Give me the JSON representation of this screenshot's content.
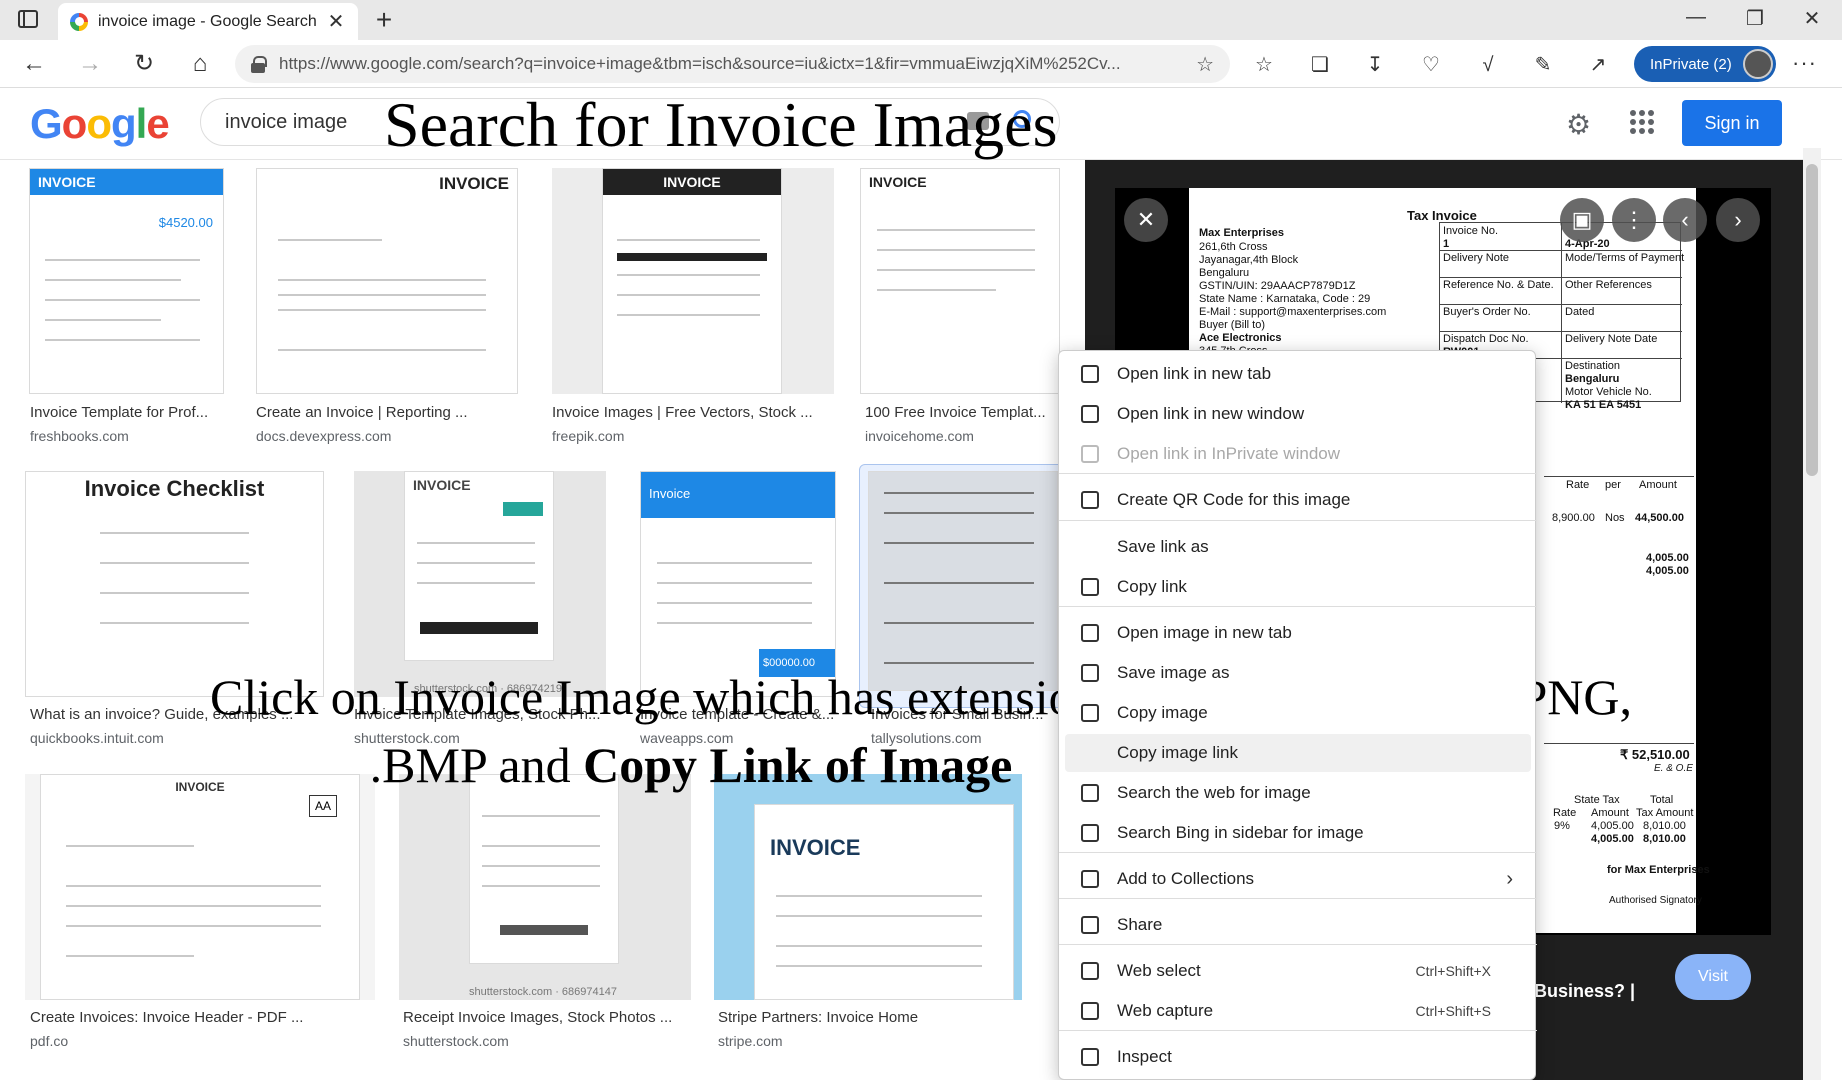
{
  "browser": {
    "tab_title": "invoice image - Google Search",
    "tab_close": "✕",
    "new_tab": "+",
    "url": "https://www.google.com/search?q=invoice+image&tbm=isch&source=iu&ictx=1&fir=vmmuaEiwzjqXiM%252Cv...",
    "inprivate_label": "InPrivate (2)",
    "window_minimize": "—",
    "window_restore": "❐",
    "window_close": "✕",
    "more": "···"
  },
  "google": {
    "logo": "Google",
    "search_value": "invoice image",
    "signin_label": "Sign in"
  },
  "overlay": {
    "title": "Search for Invoice Images",
    "caption_line1": "Click on Invoice Image which has extensions like- .JPEG, .JPG, .PNG,",
    "caption_line2_plain": ".BMP and ",
    "caption_line2_bold": "Copy Link of Image"
  },
  "results": [
    {
      "title": "Invoice Template for Prof...",
      "source": "freshbooks.com",
      "thumb_heading": "INVOICE",
      "thumb_amount": "$4520.00"
    },
    {
      "title": "Create an Invoice | Reporting ...",
      "source": "docs.devexpress.com",
      "thumb_heading": "INVOICE"
    },
    {
      "title": "Invoice Images | Free Vectors, Stock ...",
      "source": "freepik.com",
      "thumb_heading": "INVOICE"
    },
    {
      "title": "100 Free Invoice Templat...",
      "source": "invoicehome.com",
      "thumb_heading": "INVOICE"
    },
    {
      "title": "What is an invoice? Guide, examples ...",
      "source": "quickbooks.intuit.com",
      "thumb_heading": "Invoice Checklist"
    },
    {
      "title": "Invoice Template Images, Stock Ph...",
      "source": "shutterstock.com",
      "thumb_heading": "INVOICE",
      "thumb_footer": "shutterstock.com · 686974219"
    },
    {
      "title": "Invoice template - Create &...",
      "source": "waveapps.com",
      "thumb_heading": "Invoice",
      "thumb_amount": "$00000.00"
    },
    {
      "title": "Invoices for Small Busin...",
      "source": "tallysolutions.com"
    },
    {
      "title": "Create Invoices: Invoice Header - PDF ...",
      "source": "pdf.co",
      "thumb_heading": "INVOICE",
      "thumb_badge": "AA"
    },
    {
      "title": "Receipt Invoice Images, Stock Photos ...",
      "source": "shutterstock.com",
      "thumb_footer": "shutterstock.com · 686974147"
    },
    {
      "title": "Stripe Partners: Invoice Home",
      "source": "stripe.com",
      "thumb_heading": "INVOICE"
    }
  ],
  "preview": {
    "doc_title": "Tax Invoice",
    "seller_name": "Max Enterprises",
    "seller_addr1": "261,6th Cross",
    "seller_addr2": "Jayanagar,4th Block",
    "seller_addr3": "Bengaluru",
    "seller_gstin": "GSTIN/UIN: 29AAACP7879D1Z",
    "seller_state": "State Name :  Karnataka, Code : 29",
    "seller_email": "E-Mail : support@maxenterprises.com",
    "buyer_label": "Buyer (Bill to)",
    "buyer_name": "Ace Electronics",
    "buyer_addr": "345 7th Cross",
    "invoice_no_label": "Invoice No.",
    "invoice_no": "1",
    "dated_value": "4-Apr-20",
    "delivery_note": "Delivery Note",
    "mode_terms": "Mode/Terms of Payment",
    "ref_no": "Reference No. & Date.",
    "other_refs": "Other References",
    "buyer_order": "Buyer's Order No.",
    "dated": "Dated",
    "dispatch_doc": "Dispatch Doc No.",
    "dispatch_value": "RW001",
    "delivery_note_date": "Delivery Note Date",
    "destination": "Destination",
    "destination_value": "Bengaluru",
    "motor_vehicle": "Motor Vehicle No.",
    "vehicle_value": "KA 51 EA 5451",
    "rate_h": "Rate",
    "per_h": "per",
    "amount_h": "Amount",
    "rate_v": "8,900.00",
    "per_v": "Nos",
    "amount_v": "44,500.00",
    "tax1": "4,005.00",
    "tax2": "4,005.00",
    "total": "₹ 52,510.00",
    "eoe": "E. & O.E",
    "state_tax": "State Tax",
    "total_tax_h": "Total",
    "rate_h2": "Rate",
    "amount_h2": "Amount",
    "tax_amount_h": "Tax Amount",
    "tax_rate_v": "9%",
    "tax_amount_v": "4,005.00",
    "tax_total_v": "8,010.00",
    "tax_amount_v2": "4,005.00",
    "tax_total_v2": "8,010.00",
    "for_company": "for Max Enterprises",
    "signatory": "Authorised Signatory",
    "business_text": "Business? |",
    "visit_label": "Visit",
    "close_glyph": "✕",
    "prev_glyph": "‹",
    "next_glyph": "›",
    "more_glyph": "⋮"
  },
  "context_menu": {
    "items": [
      {
        "label": "Open link in new tab",
        "icon": "new-tab-icon"
      },
      {
        "label": "Open link in new window",
        "icon": "window-icon"
      },
      {
        "label": "Open link in InPrivate window",
        "icon": "inprivate-icon",
        "disabled": true
      },
      {
        "label": "Create QR Code for this image",
        "icon": "qr-code-icon"
      },
      {
        "label": "Save link as",
        "icon": ""
      },
      {
        "label": "Copy link",
        "icon": "link-icon"
      },
      {
        "label": "Open image in new tab",
        "icon": "image-tab-icon"
      },
      {
        "label": "Save image as",
        "icon": "save-image-icon"
      },
      {
        "label": "Copy image",
        "icon": "copy-image-icon"
      },
      {
        "label": "Copy image link",
        "icon": "",
        "hovered": true
      },
      {
        "label": "Search the web for image",
        "icon": "search-image-icon"
      },
      {
        "label": "Search Bing in sidebar for image",
        "icon": "bing-sidebar-icon"
      },
      {
        "label": "Add to Collections",
        "icon": "collections-icon",
        "submenu": true
      },
      {
        "label": "Share",
        "icon": "share-icon"
      },
      {
        "label": "Web select",
        "icon": "web-select-icon",
        "shortcut": "Ctrl+Shift+X"
      },
      {
        "label": "Web capture",
        "icon": "web-capture-icon",
        "shortcut": "Ctrl+Shift+S"
      },
      {
        "label": "Inspect",
        "icon": "inspect-icon"
      }
    ]
  }
}
